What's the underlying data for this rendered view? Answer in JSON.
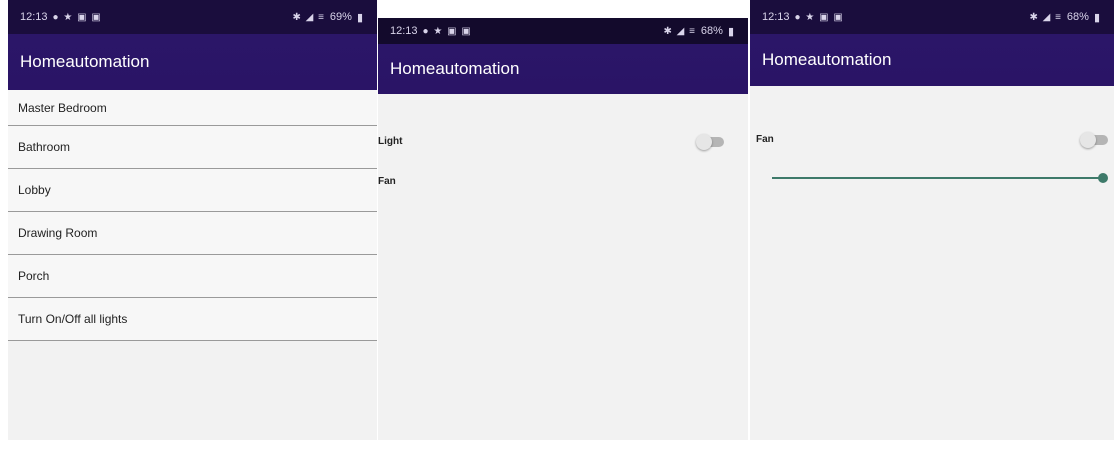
{
  "colors": {
    "app_bar": "#2a1466",
    "status_bar": "#1a0d3d",
    "slider_accent": "#3e7a6a",
    "background": "#f2f2f2"
  },
  "screens": [
    {
      "status": {
        "time": "12:13",
        "left_icons": "● ★ ▣ ▣",
        "right_icons": "✱ ◢ ≡",
        "battery": "69%"
      },
      "app_title": "Homeautomation",
      "rooms": [
        "Master Bedroom",
        "Bathroom",
        "Lobby",
        "Drawing Room",
        "Porch",
        "Turn On/Off all lights"
      ]
    },
    {
      "status": {
        "time": "12:13",
        "left_icons": "● ★ ▣ ▣",
        "right_icons": "✱ ◢ ≡",
        "battery": "68%"
      },
      "app_title": "Homeautomation",
      "controls": [
        {
          "label": "Light",
          "toggle_on": false
        },
        {
          "label": "Fan"
        }
      ]
    },
    {
      "status": {
        "time": "12:13",
        "left_icons": "● ★ ▣ ▣",
        "right_icons": "✱ ◢ ≡",
        "battery": "68%"
      },
      "app_title": "Homeautomation",
      "controls": [
        {
          "label": "Fan",
          "toggle_on": false
        }
      ],
      "fan_speed_fraction": 1.0
    }
  ]
}
